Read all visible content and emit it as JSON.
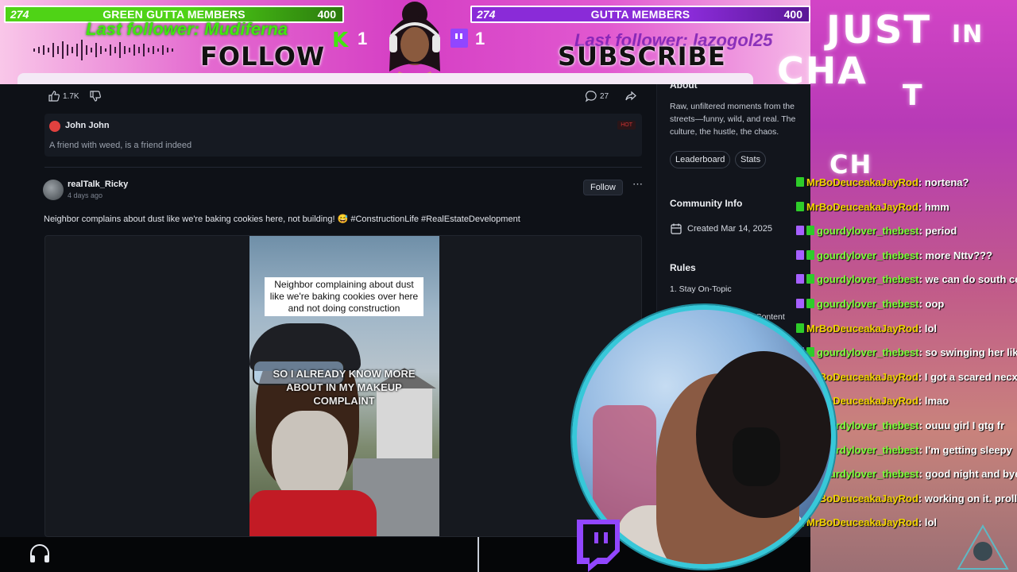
{
  "overlay": {
    "green_bar": {
      "count_left": "274",
      "title": "GREEN GUTTA MEMBERS",
      "count_right": "400"
    },
    "purple_bar": {
      "count_left": "274",
      "title": "GUTTA MEMBERS",
      "count_right": "400"
    },
    "last_follower_left": "Last follower: Mudiferna",
    "last_follower_right": "Last follower: lazogol25",
    "follow_word": "FOLLOW",
    "subscribe_word": "SUBSCRIBE",
    "kick_count": "1",
    "twitch_count": "1",
    "colors": {
      "green": "#4fd316",
      "purple": "#8a2bd8",
      "pink_bg": "#d53ec4"
    }
  },
  "right_banner": {
    "word1": "JUST",
    "word2": "IN",
    "word3": "CHA",
    "word4": "T",
    "word5": "CH"
  },
  "post": {
    "likes": "1.7K",
    "comments": "27",
    "top_comment": {
      "name": "John John",
      "tag": "HOT",
      "text": "A friend with weed, is a friend indeed"
    },
    "author": "realTalk_Ricky",
    "time": "4 days ago",
    "follow_label": "Follow",
    "more_label": "⋯",
    "text": "Neighbor complains about dust like we're baking cookies here, not building! 😅 #ConstructionLife #RealEstateDevelopment",
    "video_caption": "Neighbor complaining about dust like we're baking cookies over here and not doing construction",
    "video_overlay": "SO I ALREADY KNOW MORE ABOUT IN MY MAKEUP COMPLAINT"
  },
  "sidebar": {
    "about_head": "About",
    "description": "Raw, unfiltered moments from the streets—funny, wild, and real. The culture, the hustle, the chaos.",
    "pills": [
      "Leaderboard",
      "Stats"
    ],
    "info_head": "Community Info",
    "created": "Created Mar 14, 2025",
    "rules_head": "Rules",
    "rule1": "1. Stay On-Topic",
    "rule2": "Content"
  },
  "chat": [
    {
      "badge": "kick",
      "user": "MrBoDeuceakaJayRod",
      "msg": "nortena?"
    },
    {
      "badge": "kick",
      "user": "MrBoDeuceakaJayRod",
      "msg": "hmm"
    },
    {
      "badge": "twitch",
      "user": "gourdylover_thebest",
      "msg": "period",
      "green": true
    },
    {
      "badge": "twitch",
      "user": "gourdylover_thebest",
      "msg": "more Nttv???",
      "green": true
    },
    {
      "badge": "twitch",
      "user": "gourdylover_thebest",
      "msg": "we can do south central ba",
      "green": true
    },
    {
      "badge": "twitch",
      "user": "gourdylover_thebest",
      "msg": "oop",
      "green": true
    },
    {
      "badge": "kick",
      "user": "MrBoDeuceakaJayRod",
      "msg": "lol"
    },
    {
      "badge": "twitch",
      "user": "gourdylover_thebest",
      "msg": "so swinging her like Rollie",
      "green": true
    },
    {
      "badge": "kick",
      "user": "MrBoDeuceakaJayRod",
      "msg": "I got a scared necx cause o"
    },
    {
      "badge": "kick",
      "user": "MrBoDeuceakaJayRod",
      "msg": "lmao"
    },
    {
      "badge": "twitch",
      "user": "gourdylover_thebest",
      "msg": "ouuu girl I gtg fr",
      "green": true
    },
    {
      "badge": "twitch",
      "user": "gourdylover_thebest",
      "msg": "I'm getting sleepy",
      "green": true
    },
    {
      "badge": "twitch",
      "user": "gourdylover_thebest",
      "msg": "good night and bye Melanie",
      "green": true
    },
    {
      "badge": "kick",
      "user": "MrBoDeuceakaJayRod",
      "msg": "working on it. prolly today"
    },
    {
      "badge": "kick",
      "user": "MrBoDeuceakaJayRod",
      "msg": "lol"
    }
  ]
}
